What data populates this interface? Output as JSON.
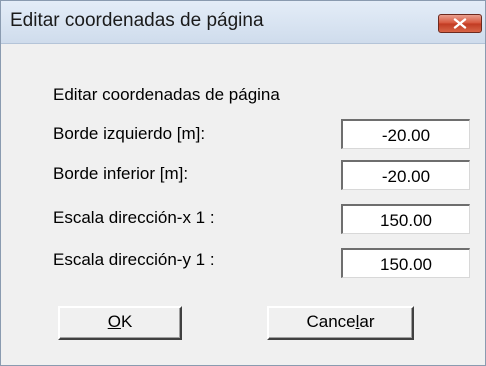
{
  "window": {
    "title": "Editar coordenadas de página",
    "close_icon": "close-icon"
  },
  "dialog": {
    "heading": "Editar coordenadas de página",
    "fields": [
      {
        "label": "Borde izquierdo [m]:",
        "value": "-20.00"
      },
      {
        "label": "Borde inferior [m]:",
        "value": "-20.00"
      },
      {
        "label": "Escala dirección-x 1 :",
        "value": "150.00"
      },
      {
        "label": "Escala dirección-y 1 :",
        "value": "150.00"
      }
    ]
  },
  "buttons": {
    "ok_mnemonic": "O",
    "ok_rest": "K",
    "cancel_prefix": "Cance",
    "cancel_mnemonic": "l",
    "cancel_suffix": "ar"
  },
  "colors": {
    "dialog_bg": "#f0f0f0",
    "title_bar": "#dbe6f4",
    "close_button": "#c94a30"
  }
}
